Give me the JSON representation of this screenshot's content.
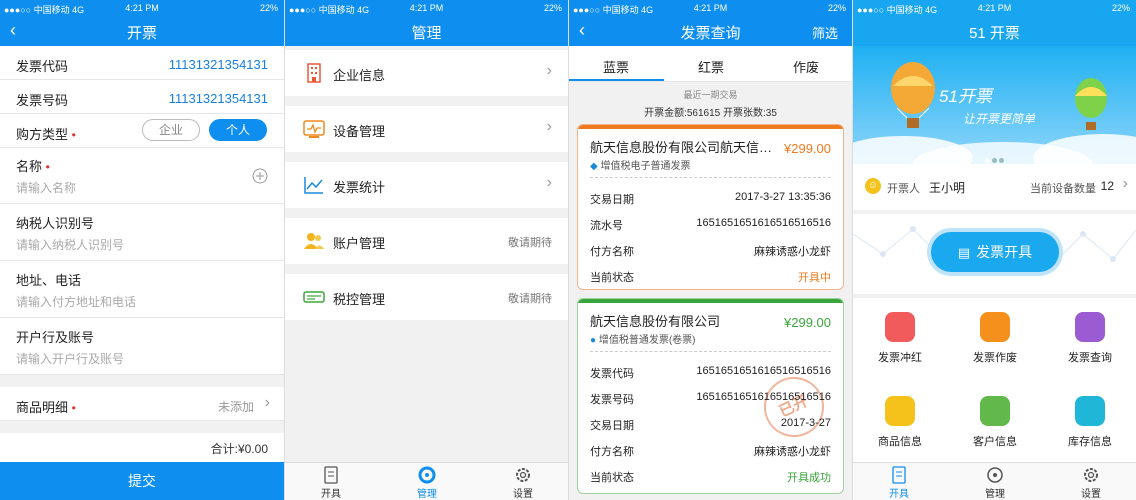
{
  "status": {
    "carrier": "●●●○○ 中国移动  4G",
    "time": "4:21 PM",
    "battery": "22%"
  },
  "s1": {
    "title": "开票",
    "fields": [
      {
        "label": "发票代码",
        "value": "11131321354131"
      },
      {
        "label": "发票号码",
        "value": "11131321354131"
      }
    ],
    "buyer_type": {
      "label": "购方类型",
      "opt1": "企业",
      "opt2": "个人"
    },
    "name": {
      "label": "名称",
      "placeholder": "请输入名称"
    },
    "taxid": {
      "label": "纳税人识别号",
      "placeholder": "请输入纳税人识别号"
    },
    "addr": {
      "label": "地址、电话",
      "placeholder": "请输入付方地址和电话"
    },
    "bank": {
      "label": "开户行及账号",
      "placeholder": "请输入开户行及账号"
    },
    "goods": {
      "label": "商品明细",
      "value": "未添加"
    },
    "total": "合计:¥0.00",
    "submit": "提交"
  },
  "s2": {
    "title": "管理",
    "items": [
      {
        "label": "企业信息",
        "extra": ""
      },
      {
        "label": "设备管理",
        "extra": ""
      },
      {
        "label": "发票统计",
        "extra": ""
      },
      {
        "label": "账户管理",
        "extra": "敬请期待"
      },
      {
        "label": "税控管理",
        "extra": "敬请期待"
      }
    ],
    "tabs": [
      "开具",
      "管理",
      "设置"
    ]
  },
  "s3": {
    "title": "发票查询",
    "filter": "筛选",
    "tabs": [
      "蓝票",
      "红票",
      "作废"
    ],
    "recent": "最近一期交易",
    "summary": "开票金额:561615   开票张数:35",
    "card1": {
      "company": "航天信息股份有限公司航天信息股份有限公司",
      "price": "¥299.00",
      "type": "增值税电子普通发票",
      "rows": [
        {
          "k": "交易日期",
          "v": "2017-3-27  13:35:36"
        },
        {
          "k": "流水号",
          "v": "1651651651616516516516"
        },
        {
          "k": "付方名称",
          "v": "麻辣诱惑小龙虾"
        },
        {
          "k": "当前状态",
          "v": "开具中"
        }
      ]
    },
    "card2": {
      "company": "航天信息股份有限公司",
      "price": "¥299.00",
      "type": "增值税普通发票(卷票)",
      "stamp": "已开",
      "rows": [
        {
          "k": "发票代码",
          "v": "1651651651616516516516"
        },
        {
          "k": "发票号码",
          "v": "1651651651616516516516"
        },
        {
          "k": "交易日期",
          "v": "2017-3-27"
        },
        {
          "k": "付方名称",
          "v": "麻辣诱惑小龙虾"
        },
        {
          "k": "当前状态",
          "v": "开具成功"
        }
      ]
    }
  },
  "s4": {
    "title": "51 开票",
    "banner_title": "51开票",
    "banner_sub": "让开票更简单",
    "issuer_label": "开票人",
    "issuer": "王小明",
    "device_label": "当前设备数量",
    "device_count": "12",
    "main_button": "发票开具",
    "features": [
      "发票冲红",
      "发票作废",
      "发票查询",
      "商品信息",
      "客户信息",
      "库存信息"
    ],
    "tabs": [
      "开具",
      "管理",
      "设置"
    ]
  },
  "colors": {
    "primary": "#0e8ff0",
    "orange": "#f07a1e",
    "green": "#3aa53a"
  }
}
